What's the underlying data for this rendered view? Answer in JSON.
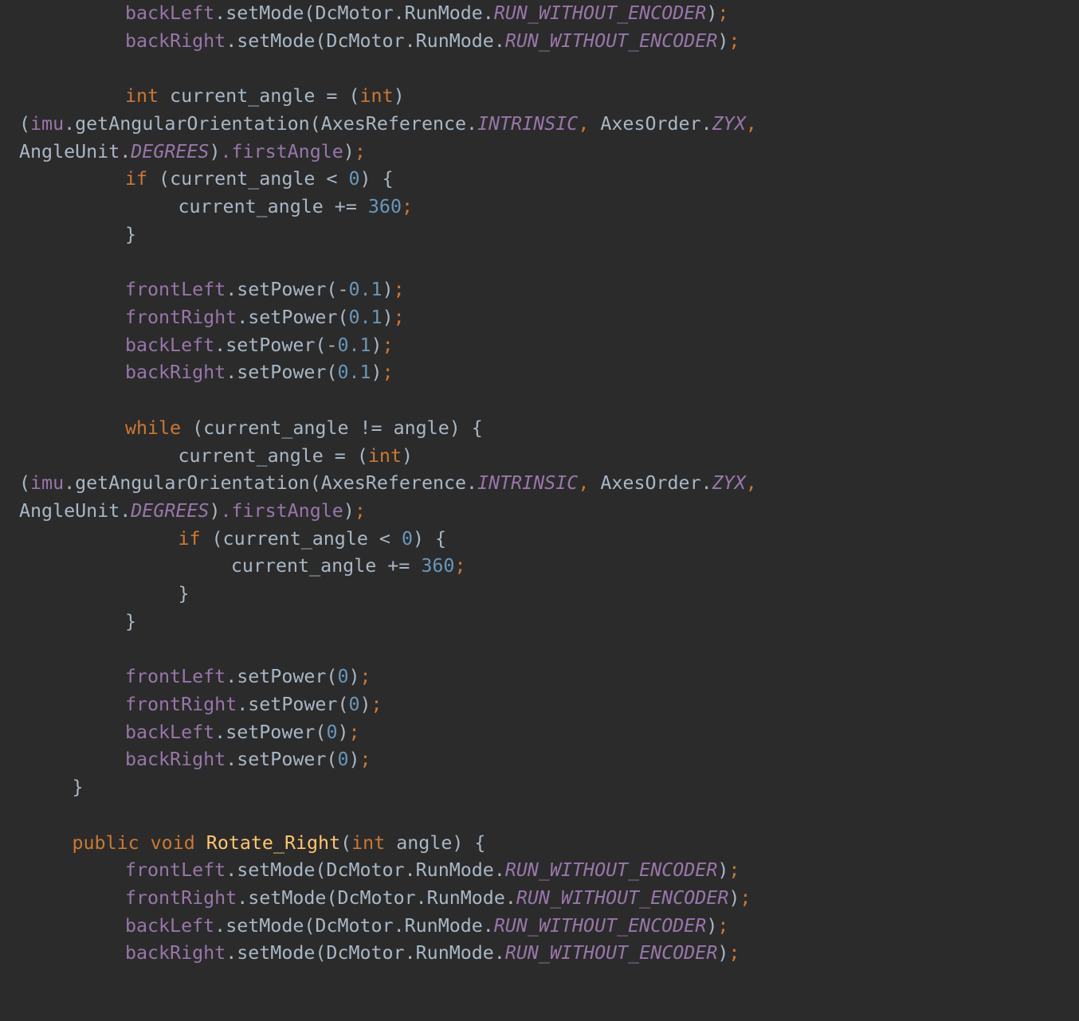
{
  "editor": {
    "language": "java",
    "theme": "darcula",
    "background_color": "#2b2b2b",
    "colors": {
      "default": "#a9b7c6",
      "keyword": "#cc7832",
      "field": "#9876aa",
      "constant": "#9876aa",
      "number": "#6897bb",
      "punctuation": "#cc7832",
      "method_declaration": "#ffc66d"
    }
  },
  "code": {
    "lines": [
      {
        "id": "line-1",
        "indent": 8,
        "tokens": [
          {
            "text": "backLeft",
            "type": "field"
          },
          {
            "text": ".setMode",
            "type": "default"
          },
          {
            "text": "(DcMotor.RunMode.",
            "type": "default"
          },
          {
            "text": "RUN_WITHOUT_ENCODER",
            "type": "const"
          },
          {
            "text": ")",
            "type": "default"
          },
          {
            "text": ";",
            "type": "punct"
          }
        ]
      },
      {
        "id": "line-2",
        "indent": 8,
        "tokens": [
          {
            "text": "backRight",
            "type": "field"
          },
          {
            "text": ".setMode",
            "type": "default"
          },
          {
            "text": "(DcMotor.RunMode.",
            "type": "default"
          },
          {
            "text": "RUN_WITHOUT_ENCODER",
            "type": "const"
          },
          {
            "text": ")",
            "type": "default"
          },
          {
            "text": ";",
            "type": "punct"
          }
        ]
      },
      {
        "id": "line-3",
        "indent": 0,
        "tokens": []
      },
      {
        "id": "line-4",
        "indent": 8,
        "tokens": [
          {
            "text": "int",
            "type": "keyword"
          },
          {
            "text": " current_angle = ",
            "type": "default"
          },
          {
            "text": "(",
            "type": "default"
          },
          {
            "text": "int",
            "type": "keyword"
          },
          {
            "text": ")",
            "type": "default"
          }
        ]
      },
      {
        "id": "line-5",
        "indent": 0,
        "wrapped": true,
        "tokens": [
          {
            "text": "(",
            "type": "default"
          },
          {
            "text": "imu",
            "type": "field"
          },
          {
            "text": ".getAngularOrientation(AxesReference.",
            "type": "default"
          },
          {
            "text": "INTRINSIC",
            "type": "const"
          },
          {
            "text": ",",
            "type": "punct"
          },
          {
            "text": " AxesOrder.",
            "type": "default"
          },
          {
            "text": "ZYX",
            "type": "const"
          },
          {
            "text": ",",
            "type": "punct"
          }
        ]
      },
      {
        "id": "line-6",
        "indent": 0,
        "wrapped": true,
        "tokens": [
          {
            "text": "AngleUnit.",
            "type": "default"
          },
          {
            "text": "DEGREES",
            "type": "const"
          },
          {
            "text": ")",
            "type": "default"
          },
          {
            "text": ".firstAngle",
            "type": "field"
          },
          {
            "text": ")",
            "type": "default"
          },
          {
            "text": ";",
            "type": "punct"
          }
        ]
      },
      {
        "id": "line-7",
        "indent": 8,
        "tokens": [
          {
            "text": "if",
            "type": "keyword"
          },
          {
            "text": " (current_angle < ",
            "type": "default"
          },
          {
            "text": "0",
            "type": "number"
          },
          {
            "text": ") {",
            "type": "default"
          }
        ]
      },
      {
        "id": "line-8",
        "indent": 12,
        "tokens": [
          {
            "text": "current_angle += ",
            "type": "default"
          },
          {
            "text": "360",
            "type": "number"
          },
          {
            "text": ";",
            "type": "punct"
          }
        ]
      },
      {
        "id": "line-9",
        "indent": 8,
        "tokens": [
          {
            "text": "}",
            "type": "default"
          }
        ]
      },
      {
        "id": "line-10",
        "indent": 0,
        "tokens": []
      },
      {
        "id": "line-11",
        "indent": 8,
        "tokens": [
          {
            "text": "frontLeft",
            "type": "field"
          },
          {
            "text": ".setPower",
            "type": "default"
          },
          {
            "text": "(-",
            "type": "default"
          },
          {
            "text": "0.1",
            "type": "number"
          },
          {
            "text": ")",
            "type": "default"
          },
          {
            "text": ";",
            "type": "punct"
          }
        ]
      },
      {
        "id": "line-12",
        "indent": 8,
        "tokens": [
          {
            "text": "frontRight",
            "type": "field"
          },
          {
            "text": ".setPower",
            "type": "default"
          },
          {
            "text": "(",
            "type": "default"
          },
          {
            "text": "0.1",
            "type": "number"
          },
          {
            "text": ")",
            "type": "default"
          },
          {
            "text": ";",
            "type": "punct"
          }
        ]
      },
      {
        "id": "line-13",
        "indent": 8,
        "tokens": [
          {
            "text": "backLeft",
            "type": "field"
          },
          {
            "text": ".setPower",
            "type": "default"
          },
          {
            "text": "(-",
            "type": "default"
          },
          {
            "text": "0.1",
            "type": "number"
          },
          {
            "text": ")",
            "type": "default"
          },
          {
            "text": ";",
            "type": "punct"
          }
        ]
      },
      {
        "id": "line-14",
        "indent": 8,
        "tokens": [
          {
            "text": "backRight",
            "type": "field"
          },
          {
            "text": ".setPower",
            "type": "default"
          },
          {
            "text": "(",
            "type": "default"
          },
          {
            "text": "0.1",
            "type": "number"
          },
          {
            "text": ")",
            "type": "default"
          },
          {
            "text": ";",
            "type": "punct"
          }
        ]
      },
      {
        "id": "line-15",
        "indent": 0,
        "tokens": []
      },
      {
        "id": "line-16",
        "indent": 8,
        "tokens": [
          {
            "text": "while",
            "type": "keyword"
          },
          {
            "text": " (current_angle != angle) {",
            "type": "default"
          }
        ]
      },
      {
        "id": "line-17",
        "indent": 12,
        "tokens": [
          {
            "text": "current_angle = ",
            "type": "default"
          },
          {
            "text": "(",
            "type": "default"
          },
          {
            "text": "int",
            "type": "keyword"
          },
          {
            "text": ")",
            "type": "default"
          }
        ]
      },
      {
        "id": "line-18",
        "indent": 0,
        "wrapped": true,
        "tokens": [
          {
            "text": "(",
            "type": "default"
          },
          {
            "text": "imu",
            "type": "field"
          },
          {
            "text": ".getAngularOrientation(AxesReference.",
            "type": "default"
          },
          {
            "text": "INTRINSIC",
            "type": "const"
          },
          {
            "text": ",",
            "type": "punct"
          },
          {
            "text": " AxesOrder.",
            "type": "default"
          },
          {
            "text": "ZYX",
            "type": "const"
          },
          {
            "text": ",",
            "type": "punct"
          }
        ]
      },
      {
        "id": "line-19",
        "indent": 0,
        "wrapped": true,
        "tokens": [
          {
            "text": "AngleUnit.",
            "type": "default"
          },
          {
            "text": "DEGREES",
            "type": "const"
          },
          {
            "text": ")",
            "type": "default"
          },
          {
            "text": ".firstAngle",
            "type": "field"
          },
          {
            "text": ")",
            "type": "default"
          },
          {
            "text": ";",
            "type": "punct"
          }
        ]
      },
      {
        "id": "line-20",
        "indent": 12,
        "tokens": [
          {
            "text": "if",
            "type": "keyword"
          },
          {
            "text": " (current_angle < ",
            "type": "default"
          },
          {
            "text": "0",
            "type": "number"
          },
          {
            "text": ") {",
            "type": "default"
          }
        ]
      },
      {
        "id": "line-21",
        "indent": 16,
        "tokens": [
          {
            "text": "current_angle += ",
            "type": "default"
          },
          {
            "text": "360",
            "type": "number"
          },
          {
            "text": ";",
            "type": "punct"
          }
        ]
      },
      {
        "id": "line-22",
        "indent": 12,
        "tokens": [
          {
            "text": "}",
            "type": "default"
          }
        ]
      },
      {
        "id": "line-23",
        "indent": 8,
        "tokens": [
          {
            "text": "}",
            "type": "default"
          }
        ]
      },
      {
        "id": "line-24",
        "indent": 0,
        "tokens": []
      },
      {
        "id": "line-25",
        "indent": 8,
        "tokens": [
          {
            "text": "frontLeft",
            "type": "field"
          },
          {
            "text": ".setPower",
            "type": "default"
          },
          {
            "text": "(",
            "type": "default"
          },
          {
            "text": "0",
            "type": "number"
          },
          {
            "text": ")",
            "type": "default"
          },
          {
            "text": ";",
            "type": "punct"
          }
        ]
      },
      {
        "id": "line-26",
        "indent": 8,
        "tokens": [
          {
            "text": "frontRight",
            "type": "field"
          },
          {
            "text": ".setPower",
            "type": "default"
          },
          {
            "text": "(",
            "type": "default"
          },
          {
            "text": "0",
            "type": "number"
          },
          {
            "text": ")",
            "type": "default"
          },
          {
            "text": ";",
            "type": "punct"
          }
        ]
      },
      {
        "id": "line-27",
        "indent": 8,
        "tokens": [
          {
            "text": "backLeft",
            "type": "field"
          },
          {
            "text": ".setPower",
            "type": "default"
          },
          {
            "text": "(",
            "type": "default"
          },
          {
            "text": "0",
            "type": "number"
          },
          {
            "text": ")",
            "type": "default"
          },
          {
            "text": ";",
            "type": "punct"
          }
        ]
      },
      {
        "id": "line-28",
        "indent": 8,
        "tokens": [
          {
            "text": "backRight",
            "type": "field"
          },
          {
            "text": ".setPower",
            "type": "default"
          },
          {
            "text": "(",
            "type": "default"
          },
          {
            "text": "0",
            "type": "number"
          },
          {
            "text": ")",
            "type": "default"
          },
          {
            "text": ";",
            "type": "punct"
          }
        ]
      },
      {
        "id": "line-29",
        "indent": 4,
        "tokens": [
          {
            "text": "}",
            "type": "default"
          }
        ]
      },
      {
        "id": "line-30",
        "indent": 0,
        "tokens": []
      },
      {
        "id": "line-31",
        "indent": 4,
        "tokens": [
          {
            "text": "public void",
            "type": "keyword"
          },
          {
            "text": " ",
            "type": "default"
          },
          {
            "text": "Rotate_Right",
            "type": "method"
          },
          {
            "text": "(",
            "type": "default"
          },
          {
            "text": "int",
            "type": "keyword"
          },
          {
            "text": " angle) {",
            "type": "default"
          }
        ]
      },
      {
        "id": "line-32",
        "indent": 8,
        "tokens": [
          {
            "text": "frontLeft",
            "type": "field"
          },
          {
            "text": ".setMode",
            "type": "default"
          },
          {
            "text": "(DcMotor.RunMode.",
            "type": "default"
          },
          {
            "text": "RUN_WITHOUT_ENCODER",
            "type": "const"
          },
          {
            "text": ")",
            "type": "default"
          },
          {
            "text": ";",
            "type": "punct"
          }
        ]
      },
      {
        "id": "line-33",
        "indent": 8,
        "tokens": [
          {
            "text": "frontRight",
            "type": "field"
          },
          {
            "text": ".setMode",
            "type": "default"
          },
          {
            "text": "(DcMotor.RunMode.",
            "type": "default"
          },
          {
            "text": "RUN_WITHOUT_ENCODER",
            "type": "const"
          },
          {
            "text": ")",
            "type": "default"
          },
          {
            "text": ";",
            "type": "punct"
          }
        ]
      },
      {
        "id": "line-34",
        "indent": 8,
        "tokens": [
          {
            "text": "backLeft",
            "type": "field"
          },
          {
            "text": ".setMode",
            "type": "default"
          },
          {
            "text": "(DcMotor.RunMode.",
            "type": "default"
          },
          {
            "text": "RUN_WITHOUT_ENCODER",
            "type": "const"
          },
          {
            "text": ")",
            "type": "default"
          },
          {
            "text": ";",
            "type": "punct"
          }
        ]
      },
      {
        "id": "line-35",
        "indent": 8,
        "tokens": [
          {
            "text": "backRight",
            "type": "field"
          },
          {
            "text": ".setMode",
            "type": "default"
          },
          {
            "text": "(DcMotor.RunMode.",
            "type": "default"
          },
          {
            "text": "RUN_WITHOUT_ENCODER",
            "type": "const"
          },
          {
            "text": ")",
            "type": "default"
          },
          {
            "text": ";",
            "type": "punct"
          }
        ]
      }
    ]
  }
}
